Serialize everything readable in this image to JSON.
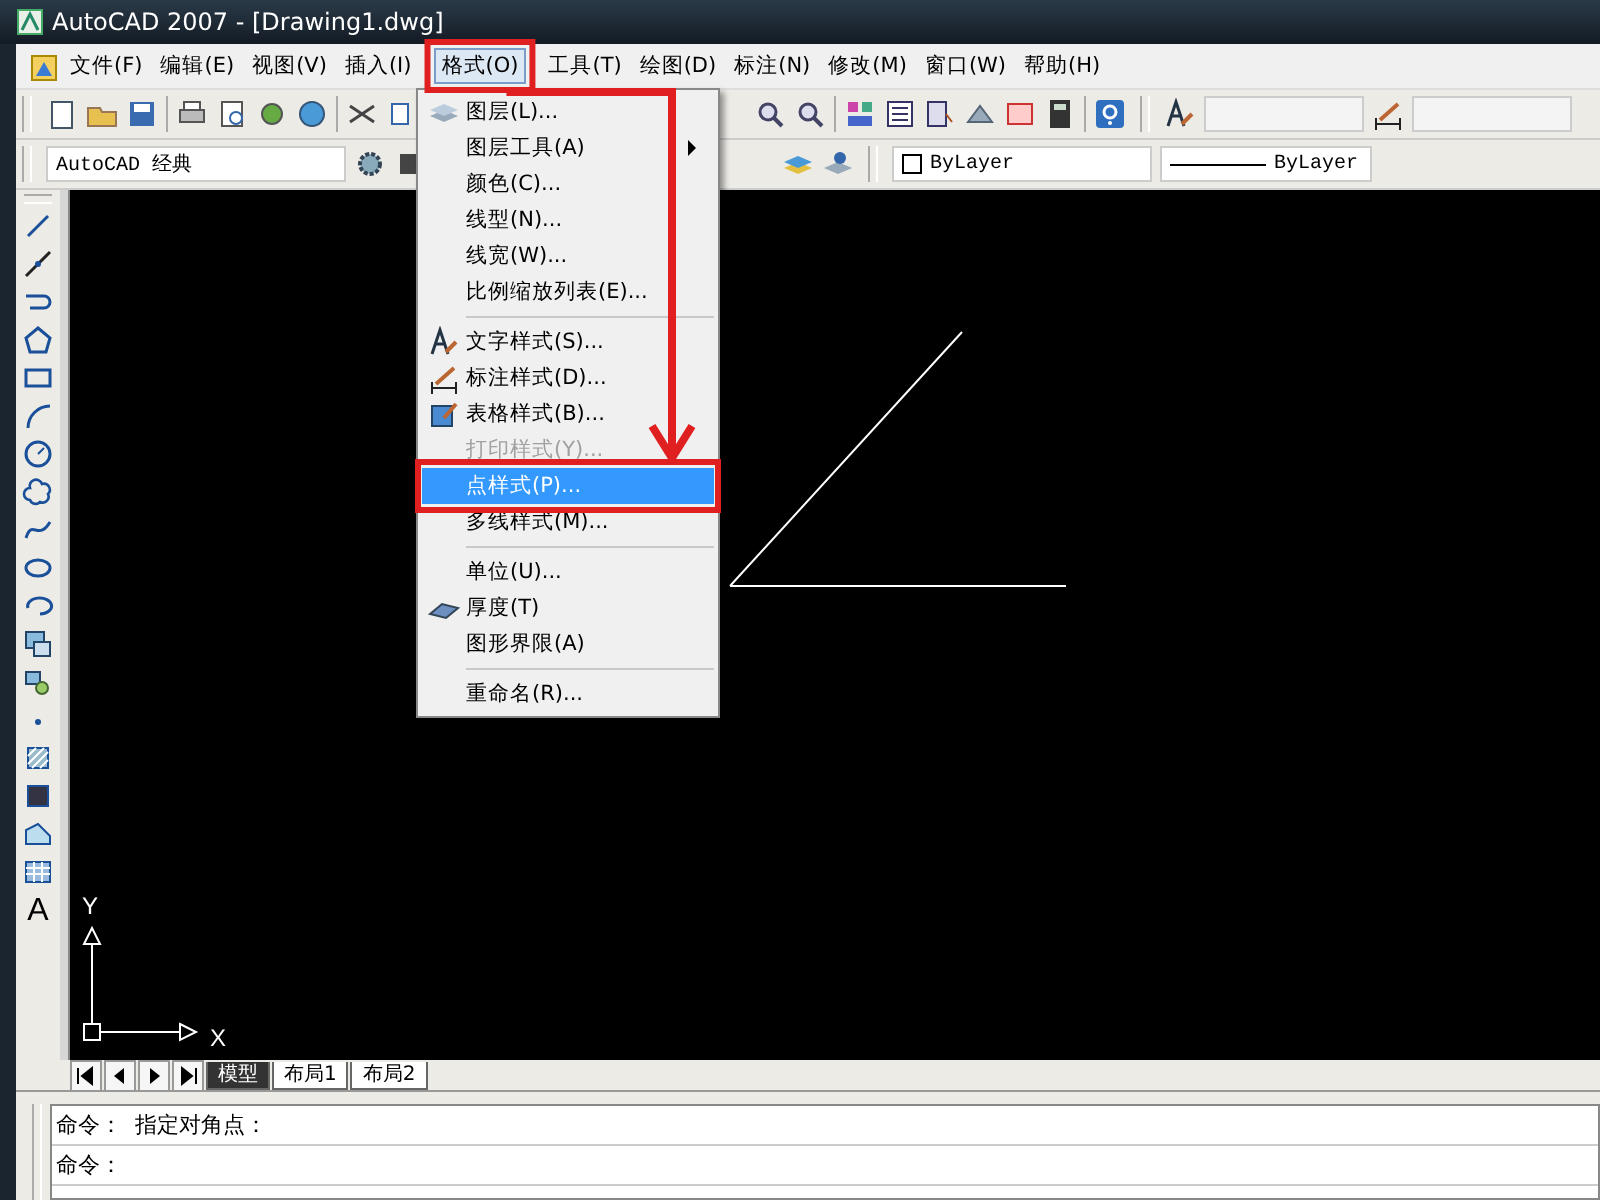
{
  "window": {
    "title": "AutoCAD 2007 - [Drawing1.dwg]"
  },
  "menu_bar": [
    {
      "label": "文件(F)",
      "selected": false
    },
    {
      "label": "编辑(E)",
      "selected": false
    },
    {
      "label": "视图(V)",
      "selected": false
    },
    {
      "label": "插入(I)",
      "selected": false
    },
    {
      "label": "格式(O)",
      "selected": true
    },
    {
      "label": "工具(T)",
      "selected": false
    },
    {
      "label": "绘图(D)",
      "selected": false
    },
    {
      "label": "标注(N)",
      "selected": false
    },
    {
      "label": "修改(M)",
      "selected": false
    },
    {
      "label": "窗口(W)",
      "selected": false
    },
    {
      "label": "帮助(H)",
      "selected": false
    }
  ],
  "format_menu": {
    "groups": [
      [
        {
          "label": "图层(L)...",
          "selected": false,
          "disabled": false,
          "submenu": false
        },
        {
          "label": "图层工具(A)",
          "selected": false,
          "disabled": false,
          "submenu": true
        },
        {
          "label": "颜色(C)...",
          "selected": false,
          "disabled": false,
          "submenu": false
        },
        {
          "label": "线型(N)...",
          "selected": false,
          "disabled": false,
          "submenu": false
        },
        {
          "label": "线宽(W)...",
          "selected": false,
          "disabled": false,
          "submenu": false
        },
        {
          "label": "比例缩放列表(E)...",
          "selected": false,
          "disabled": false,
          "submenu": false
        }
      ],
      [
        {
          "label": "文字样式(S)...",
          "selected": false,
          "disabled": false,
          "submenu": false
        },
        {
          "label": "标注样式(D)...",
          "selected": false,
          "disabled": false,
          "submenu": false
        },
        {
          "label": "表格样式(B)...",
          "selected": false,
          "disabled": false,
          "submenu": false
        },
        {
          "label": "打印样式(Y)...",
          "selected": false,
          "disabled": true,
          "submenu": false
        },
        {
          "label": "点样式(P)...",
          "selected": true,
          "disabled": false,
          "submenu": false
        },
        {
          "label": "多线样式(M)...",
          "selected": false,
          "disabled": false,
          "submenu": false
        }
      ],
      [
        {
          "label": "单位(U)...",
          "selected": false,
          "disabled": false,
          "submenu": false
        },
        {
          "label": "厚度(T)",
          "selected": false,
          "disabled": false,
          "submenu": false
        },
        {
          "label": "图形界限(A)",
          "selected": false,
          "disabled": false,
          "submenu": false
        }
      ],
      [
        {
          "label": "重命名(R)...",
          "selected": false,
          "disabled": false,
          "submenu": false
        }
      ]
    ]
  },
  "workspace_combo": {
    "value": "AutoCAD 经典"
  },
  "color_combo": {
    "value": "ByLayer"
  },
  "linetype_combo": {
    "value": "ByLayer"
  },
  "draw_toolbar": {
    "text_tool": "A"
  },
  "ucs": {
    "x_label": "X",
    "y_label": "Y"
  },
  "layout_tabs": [
    {
      "label": "模型",
      "selected": true
    },
    {
      "label": "布局1",
      "selected": false
    },
    {
      "label": "布局2",
      "selected": false
    }
  ],
  "command_lines": [
    "命令： 指定对角点：",
    "命令："
  ]
}
